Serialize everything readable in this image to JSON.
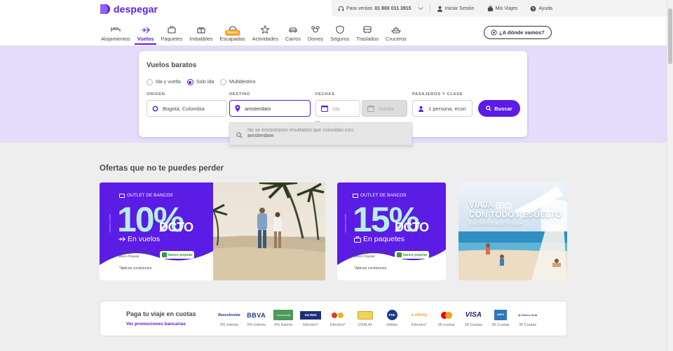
{
  "brand": {
    "name": "despegar",
    "color": "#5b1ce6"
  },
  "topbar": {
    "sales_label": "Para ventas",
    "sales_phone": "01 800 011 3915",
    "login": "Iniciar Sesión",
    "trips": "Mis Viajes",
    "help": "Ayuda"
  },
  "nav": {
    "tabs": [
      {
        "label": "Alojamientos",
        "icon": "bed-icon"
      },
      {
        "label": "Vuelos",
        "icon": "plane-icon",
        "active": true
      },
      {
        "label": "Paquetes",
        "icon": "suitcase-icon"
      },
      {
        "label": "Imbatibles",
        "icon": "gift-icon"
      },
      {
        "label": "Escapadas",
        "icon": "umbrella-icon",
        "badge": "Nuevo"
      },
      {
        "label": "Actividades",
        "icon": "star-icon"
      },
      {
        "label": "Carros",
        "icon": "car-icon"
      },
      {
        "label": "Disney",
        "icon": "mickey-icon"
      },
      {
        "label": "Seguros",
        "icon": "shield-icon"
      },
      {
        "label": "Traslados",
        "icon": "bus-icon"
      },
      {
        "label": "Cruceros",
        "icon": "ship-icon"
      }
    ],
    "where_button": "¿A dónde vamos?"
  },
  "search": {
    "title": "Vuelos baratos",
    "trip_types": [
      {
        "label": "Ida y vuelta",
        "selected": false
      },
      {
        "label": "Solo ida",
        "selected": true
      },
      {
        "label": "Multidestino",
        "selected": false
      }
    ],
    "origin": {
      "label": "ORIGEN",
      "value": "Bogotá, Colombia"
    },
    "destination": {
      "label": "DESTINO",
      "value": "amsterdam"
    },
    "dates": {
      "label": "FECHAS",
      "departure_placeholder": "Ida",
      "return_placeholder": "Vuelta"
    },
    "passengers": {
      "label": "PASAJEROS Y CLASE",
      "value": "1 persona, econ"
    },
    "submit": "Buscar",
    "no_results": {
      "message": "No se encontraron resultados que coincidan con:",
      "query": "amsterdam"
    }
  },
  "offers": {
    "title": "Ofertas que no te puedes perder",
    "cards": [
      {
        "tag": "OUTLET DE BANCOS",
        "percent": "10%",
        "dcto": "DCTO",
        "product": "En vuelos",
        "condition_text": "Con Tarjetas de Crédito Banco Popular",
        "bank": "banco popular",
        "fine_print": "*Aplican condiciones."
      },
      {
        "tag": "OUTLET DE BANCOS",
        "percent": "15%",
        "dcto": "DCTO",
        "product": "En paquetes",
        "condition_text": "Con Tarjetas de Crédito Banco Popular",
        "bank": "banco popular",
        "fine_print": "*Aplican condiciones."
      },
      {
        "headline1": "VIAJA",
        "headline2": "CON TODO RESUELTO",
        "subline": "Encuentra aquí tu viaje"
      }
    ]
  },
  "payments": {
    "title": "Paga tu viaje en cuotas",
    "link": "Ver promociones bancarias",
    "methods": [
      {
        "name": "Bancolombia",
        "caption": "0% Interés"
      },
      {
        "name": "BBVA",
        "caption": "0% Interés"
      },
      {
        "name": "Davivienda",
        "caption": "0% Interés"
      },
      {
        "name": "Su Red",
        "caption": "Efectivo*"
      },
      {
        "name": "Baloto",
        "caption": "Efectivo*"
      },
      {
        "name": "Usalai",
        "caption": "ÜSALAI"
      },
      {
        "name": "PSE",
        "caption": "Débito"
      },
      {
        "name": "efecty",
        "caption": "Efectivo*"
      },
      {
        "name": "Mastercard",
        "caption": "36 cuotas"
      },
      {
        "name": "VISA",
        "caption": "36 Cuotas"
      },
      {
        "name": "American Express",
        "caption": "36 Cuotas"
      },
      {
        "name": "Diners Club",
        "caption": "36 Cuotas"
      }
    ]
  }
}
